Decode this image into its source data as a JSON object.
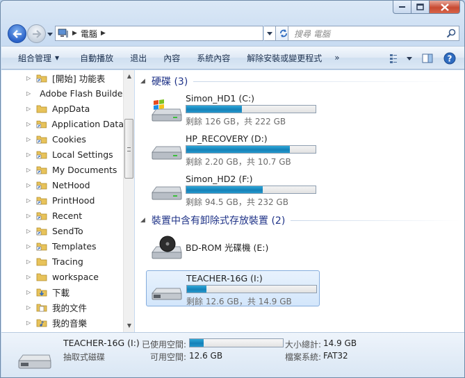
{
  "window": {
    "caption_buttons": [
      "minimize",
      "maximize",
      "close"
    ]
  },
  "address": {
    "crumb": "電腦",
    "search_placeholder": "搜尋 電腦"
  },
  "toolbar": {
    "organize": "組合管理",
    "autoplay": "自動播放",
    "eject": "退出",
    "properties": "內容",
    "system_properties": "系統內容",
    "uninstall": "解除安裝或變更程式",
    "more": "»"
  },
  "nav": {
    "items": [
      {
        "label": "[開始] 功能表",
        "icon": "shortcut-folder-icon"
      },
      {
        "label": "Adobe Flash Builder",
        "icon": "folder-icon"
      },
      {
        "label": "AppData",
        "icon": "folder-icon"
      },
      {
        "label": "Application Data",
        "icon": "shortcut-folder-icon"
      },
      {
        "label": "Cookies",
        "icon": "shortcut-folder-icon"
      },
      {
        "label": "Local Settings",
        "icon": "shortcut-folder-icon"
      },
      {
        "label": "My Documents",
        "icon": "shortcut-folder-icon"
      },
      {
        "label": "NetHood",
        "icon": "shortcut-folder-icon"
      },
      {
        "label": "PrintHood",
        "icon": "shortcut-folder-icon"
      },
      {
        "label": "Recent",
        "icon": "shortcut-folder-icon"
      },
      {
        "label": "SendTo",
        "icon": "shortcut-folder-icon"
      },
      {
        "label": "Templates",
        "icon": "shortcut-folder-icon"
      },
      {
        "label": "Tracing",
        "icon": "folder-icon"
      },
      {
        "label": "workspace",
        "icon": "folder-icon"
      },
      {
        "label": "下載",
        "icon": "download-folder-icon"
      },
      {
        "label": "我的文件",
        "icon": "documents-folder-icon"
      },
      {
        "label": "我的音樂",
        "icon": "music-folder-icon"
      }
    ]
  },
  "groups": {
    "hard_disks": "硬碟 (3)",
    "removable": "裝置中含有卸除式存放裝置 (2)"
  },
  "drives": [
    {
      "name": "Simon_HD1 (C:)",
      "free": "剩餘 126 GB，共 222 GB",
      "used_fraction": 0.43,
      "icon": "windows-drive-icon"
    },
    {
      "name": "HP_RECOVERY (D:)",
      "free": "剩餘 2.20 GB，共 10.7 GB",
      "used_fraction": 0.8,
      "icon": "hard-drive-icon"
    },
    {
      "name": "Simon_HD2 (F:)",
      "free": "剩餘 94.5 GB，共 232 GB",
      "used_fraction": 0.59,
      "icon": "hard-drive-icon"
    },
    {
      "name": "BD-ROM 光碟機 (E:)",
      "free": "",
      "icon": "bd-rom-icon"
    },
    {
      "name": "TEACHER-16G (I:)",
      "free": "剩餘 12.6 GB，共 14.9 GB",
      "used_fraction": 0.15,
      "icon": "usb-drive-icon",
      "selected": true
    }
  ],
  "details": {
    "name": "TEACHER-16G (I:)",
    "type": "抽取式磁碟",
    "used_label": "已使用空間:",
    "used_fraction": 0.15,
    "free_label": "可用空間:",
    "free_value": "12.6 GB",
    "total_label": "大小總計:",
    "total_value": "14.9 GB",
    "fs_label": "檔案系統:",
    "fs_value": "FAT32"
  },
  "colors": {
    "accent_bar": "#1a8cc4",
    "group_title": "#1e3287"
  }
}
